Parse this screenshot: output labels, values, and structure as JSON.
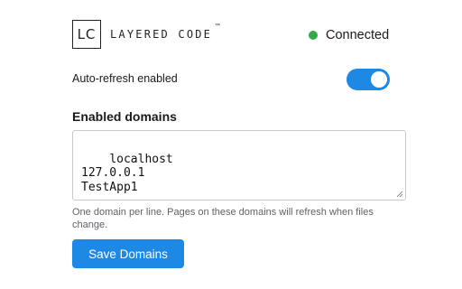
{
  "header": {
    "logo_mark": "LC",
    "logo_text": "LAYERED CODE",
    "trademark": "™",
    "status_text": "Connected",
    "status_color": "#34a84a"
  },
  "auto_refresh": {
    "label": "Auto-refresh enabled",
    "enabled": true,
    "accent_color": "#1e88e5"
  },
  "domains": {
    "heading": "Enabled domains",
    "value": "localhost\n127.0.0.1\nTestApp1",
    "hint": "One domain per line. Pages on these domains will refresh when files change.",
    "save_label": "Save Domains"
  }
}
